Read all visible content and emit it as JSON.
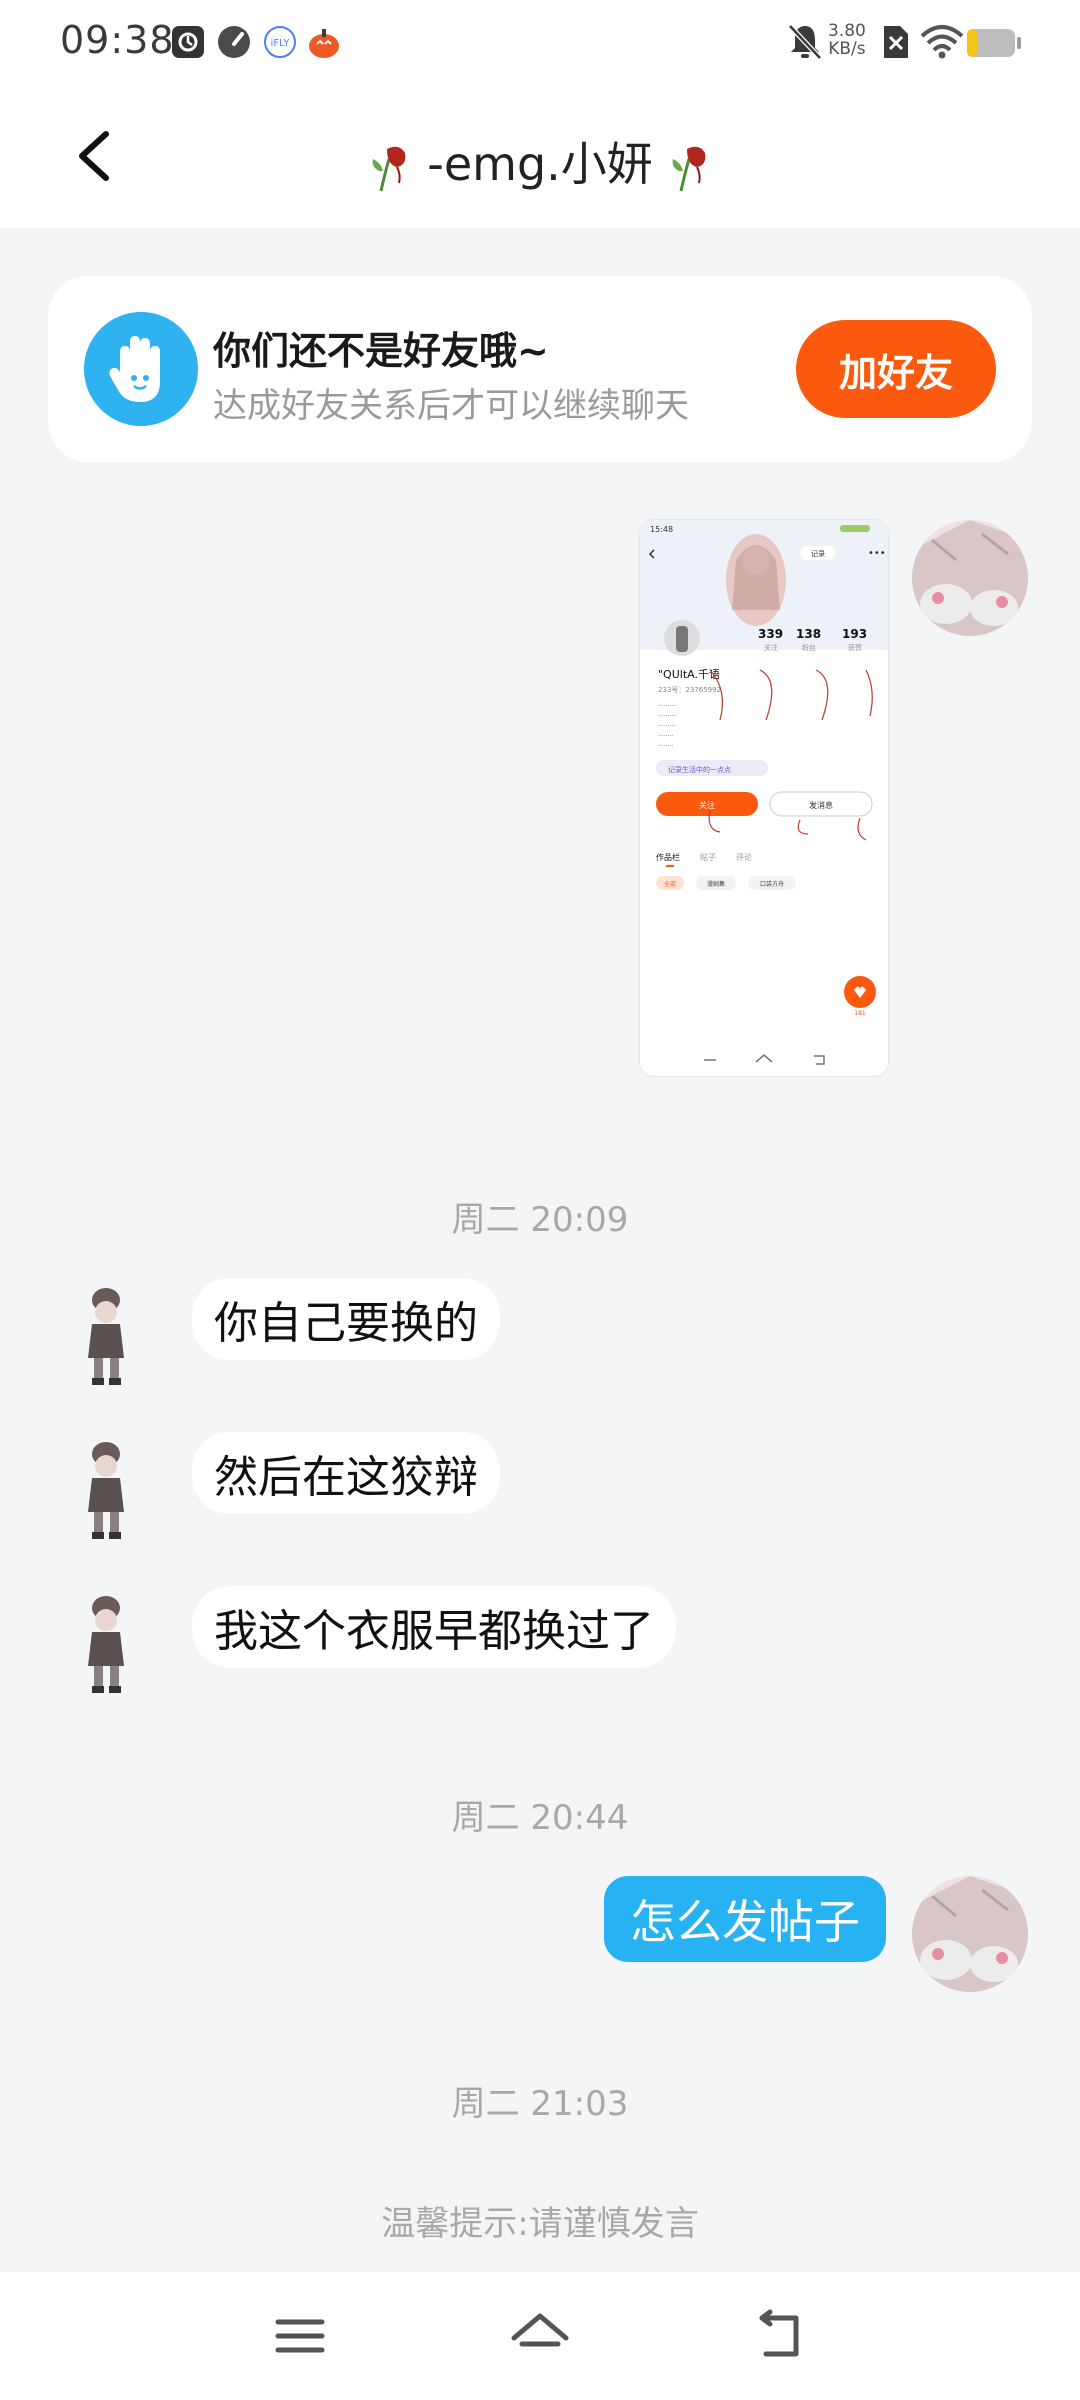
{
  "status_bar": {
    "time": "09:38",
    "net_speed_value": "3.80",
    "net_speed_unit": "KB/s",
    "icons": [
      "app-notification-icon",
      "speedometer-icon",
      "ifly-icon",
      "pumpkin-icon",
      "mute-icon",
      "sim-off-icon",
      "wifi-icon",
      "battery-icon"
    ]
  },
  "header": {
    "title": "-emg.小妍",
    "title_decoration": "wilted-rose-icon",
    "back_icon": "back-chevron-icon"
  },
  "friend_card": {
    "title": "你们还不是好友哦~",
    "subtitle": "达成好友关系后才可以继续聊天",
    "button_label": "加好友",
    "icon": "waving-hand-icon",
    "accent_color": "#fb5a0e",
    "icon_color": "#2fb3f0"
  },
  "shared_image": {
    "status_time": "15:48",
    "follow_label": "记录",
    "stats": [
      {
        "value": "339",
        "label": "关注"
      },
      {
        "value": "138",
        "label": "粉丝"
      },
      {
        "value": "193",
        "label": "获赞"
      }
    ],
    "name": "\"QUltA.千语",
    "id_line": "233号：23765992",
    "bio_lines": [
      "..........",
      "..........",
      ".........",
      "........",
      "........"
    ],
    "tag": "记录生活中的一点点",
    "follow_btn": "关注",
    "message_btn": "发消息",
    "tabs": [
      "作品栏",
      "帖子",
      "评论"
    ],
    "chips": [
      "全部",
      "漫剧集",
      "口袋方舟"
    ],
    "fab_count": "181"
  },
  "messages": [
    {
      "type": "time",
      "text": "周二 20:09"
    },
    {
      "type": "in",
      "text": "你自己要换的"
    },
    {
      "type": "in",
      "text": "然后在这狡辩"
    },
    {
      "type": "in",
      "text": "我这个衣服早都换过了"
    },
    {
      "type": "time",
      "text": "周二 20:44"
    },
    {
      "type": "out",
      "text": "怎么发帖子"
    },
    {
      "type": "time",
      "text": "周二 21:03"
    }
  ],
  "tip": "温馨提示:请谨慎发言",
  "nav_bar": {
    "icons": [
      "menu-icon",
      "home-icon",
      "back-icon"
    ]
  }
}
